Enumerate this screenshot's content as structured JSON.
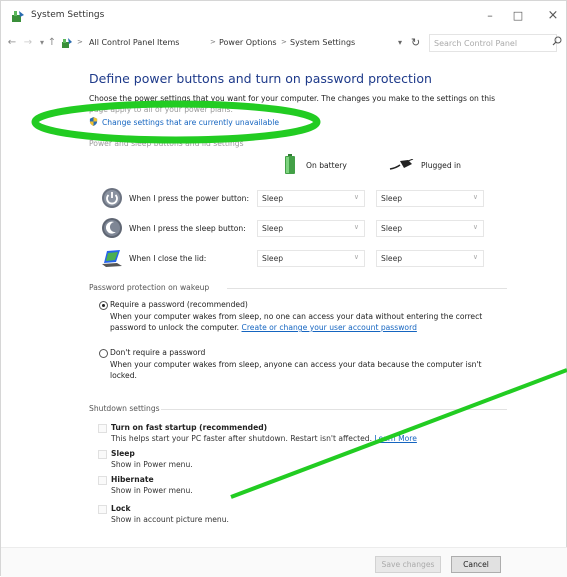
{
  "window": {
    "title": "System Settings",
    "minimize_glyph": "–",
    "maximize_glyph": "□",
    "close_glyph": "×"
  },
  "address_bar": {
    "back_glyph": "←",
    "forward_glyph": "→",
    "up_glyph": "↑",
    "dropdown_glyph": "▾",
    "crumbs": [
      "All Control Panel Items",
      "Power Options",
      "System Settings"
    ],
    "separator": ">",
    "refresh_glyph": "↻",
    "search_placeholder": "Search Control Panel",
    "icons": [
      "control-panel-icon",
      "search-icon",
      "refresh-icon"
    ]
  },
  "main": {
    "heading": "Define power buttons and turn on password protection",
    "description": "Choose the power settings that you want for your computer. The changes you make to the settings on this",
    "description_faded": "page apply to all of your power plans.",
    "change_link": "Change settings that are currently unavailable",
    "power_section_label": "Power and sleep buttons and lid settings",
    "columns": {
      "battery": "On battery",
      "plugged": "Plugged in"
    },
    "rows": [
      {
        "label": "When I press the power button:",
        "battery": "Sleep",
        "plugged": "Sleep",
        "icon": "power-button-icon"
      },
      {
        "label": "When I press the sleep button:",
        "battery": "Sleep",
        "plugged": "Sleep",
        "icon": "sleep-button-icon"
      },
      {
        "label": "When I close the lid:",
        "battery": "Sleep",
        "plugged": "Sleep",
        "icon": "laptop-lid-icon"
      }
    ],
    "password": {
      "section_label": "Password protection on wakeup",
      "require_title": "Require a password (recommended)",
      "require_desc_1": "When your computer wakes from sleep, no one can access your data without entering the correct",
      "require_desc_2": "password to unlock the computer.",
      "require_link": "Create or change your user account password",
      "no_title": "Don't require a password",
      "no_desc_1": "When your computer wakes from sleep, anyone can access your data because the computer isn't",
      "no_desc_2": "locked.",
      "selected": "require"
    },
    "shutdown": {
      "section_label": "Shutdown settings",
      "items": [
        {
          "title": "Turn on fast startup (recommended)",
          "desc": "This helps start your PC faster after shutdown. Restart isn't affected.",
          "link": "Learn More"
        },
        {
          "title": "Sleep",
          "desc": "Show in Power menu."
        },
        {
          "title": "Hibernate",
          "desc": "Show in Power menu."
        },
        {
          "title": "Lock",
          "desc": "Show in account picture menu."
        }
      ]
    }
  },
  "footer": {
    "save_label": "Save changes",
    "cancel_label": "Cancel"
  },
  "colors": {
    "heading": "#1e3a8a",
    "link": "#1565c0",
    "annotation_green": "#22cc22"
  }
}
